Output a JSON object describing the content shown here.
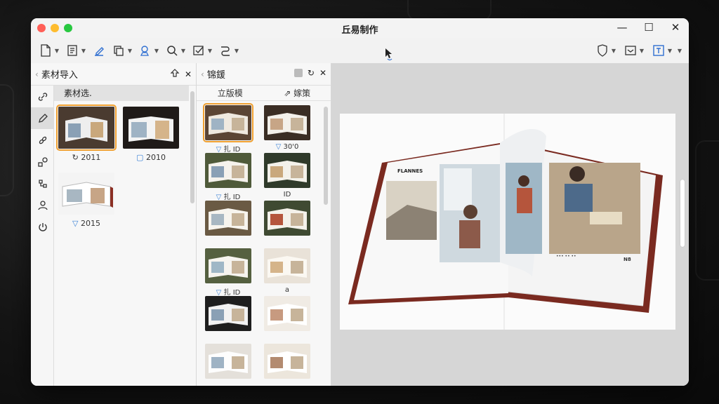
{
  "window": {
    "title": "丘易制作"
  },
  "toolbar": {
    "left_icons": [
      "new-document-icon",
      "document-outline-icon",
      "ink-pen-icon",
      "copy-pages-icon",
      "stamp-icon",
      "search-icon",
      "check-box-icon",
      "route-icon"
    ],
    "right_icons": [
      "shield-icon",
      "inbox-icon",
      "text-frame-icon"
    ]
  },
  "sidebar": {
    "icons": [
      "link-icon",
      "pen-icon",
      "chain-icon",
      "shapes-icon",
      "flow-icon",
      "user-icon",
      "power-icon"
    ]
  },
  "materials_panel": {
    "title": "素材导入",
    "section_label": "素材选.",
    "items": [
      {
        "caption": "2011",
        "mark": "↻"
      },
      {
        "caption": "2010",
        "mark": "▢"
      },
      {
        "caption": "2015",
        "mark": "▽"
      }
    ]
  },
  "layout_panel": {
    "title": "锦鍰",
    "tab_left": "立版模",
    "tab_right": "嫁策",
    "items": [
      {
        "caption": "扎 ID",
        "mark": "▽"
      },
      {
        "caption": "30'0",
        "mark": "▽"
      },
      {
        "caption": "扎 ID",
        "mark": "▽"
      },
      {
        "caption": "ID",
        "mark": ""
      },
      {
        "caption": "",
        "mark": ""
      },
      {
        "caption": "",
        "mark": ""
      },
      {
        "caption": "扎 ID",
        "mark": "▽"
      },
      {
        "caption": "a",
        "mark": ""
      }
    ]
  },
  "book_page": {
    "heading": "FLANNES",
    "footer_left": "••• •• ••",
    "footer_right": "N8"
  },
  "colors": {
    "accent": "#3b82d6",
    "selection": "#f0a030",
    "book_cover": "#7a2a20"
  }
}
